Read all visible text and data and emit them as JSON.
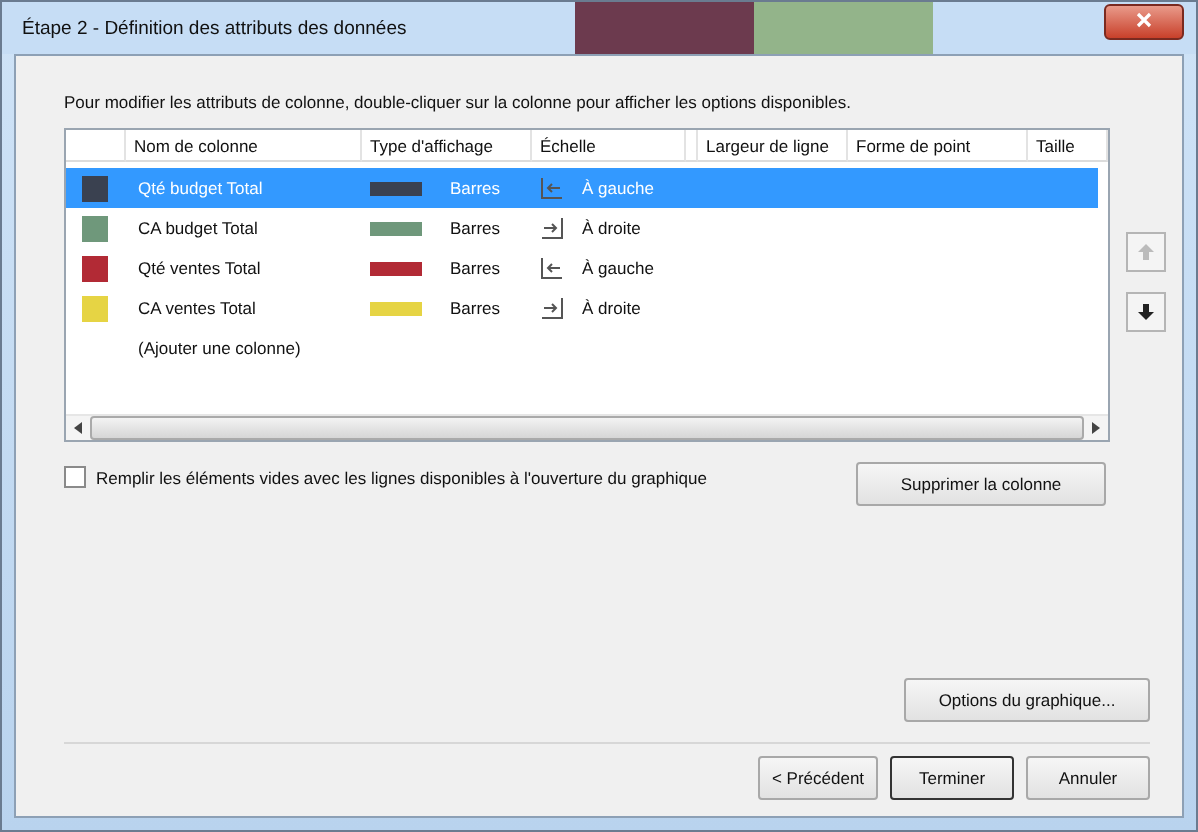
{
  "window": {
    "title": "Étape 2 - Définition des attributs des données"
  },
  "instructions": "Pour modifier les attributs de colonne, double-cliquer sur la colonne pour afficher les options disponibles.",
  "table": {
    "columns": [
      "Nom de colonne",
      "Type d'affichage",
      "Échelle",
      "Largeur de ligne",
      "Forme de point",
      "Taille"
    ],
    "rows": [
      {
        "name": "Qté budget Total",
        "color": "#3a4150",
        "display": "Barres",
        "scale": "À gauche",
        "scale_left": true,
        "selected": true
      },
      {
        "name": "CA budget Total",
        "color": "#6f987b",
        "display": "Barres",
        "scale": "À droite",
        "scale_left": false,
        "selected": false
      },
      {
        "name": "Qté ventes Total",
        "color": "#b22a35",
        "display": "Barres",
        "scale": "À gauche",
        "scale_left": true,
        "selected": false
      },
      {
        "name": "CA ventes Total",
        "color": "#e6d444",
        "display": "Barres",
        "scale": "À droite",
        "scale_left": false,
        "selected": false
      }
    ],
    "add_row": "(Ajouter une colonne)"
  },
  "move_buttons": [
    {
      "kind": "up",
      "disabled": true
    },
    {
      "kind": "down",
      "disabled": false
    }
  ],
  "fill_checkbox": {
    "label": "Remplir les éléments vides avec les lignes disponibles à l'ouverture du graphique",
    "checked": false
  },
  "delete_button": "Supprimer la colonne",
  "options_button": "Options du graphique...",
  "footer_buttons": [
    {
      "label": "< Précédent",
      "default": false
    },
    {
      "label": "Terminer",
      "default": true
    },
    {
      "label": "Annuler",
      "default": false
    }
  ]
}
